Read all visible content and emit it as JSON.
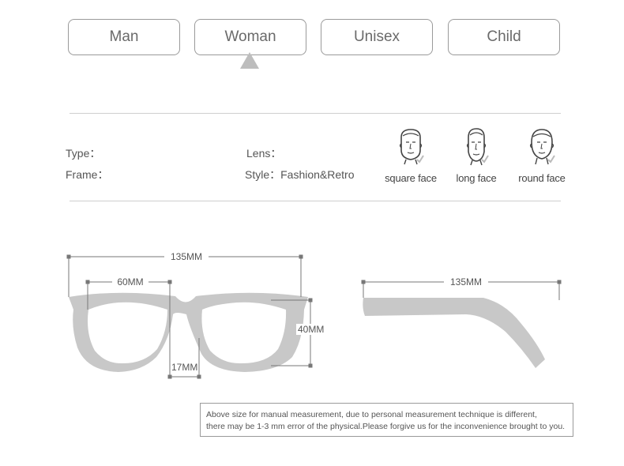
{
  "tabs": [
    {
      "label": "Man"
    },
    {
      "label": "Woman",
      "selected": true
    },
    {
      "label": "Unisex"
    },
    {
      "label": "Child"
    }
  ],
  "specs": {
    "type_label": "Type：",
    "frame_label": "Frame：",
    "lens_label": "Lens：",
    "style_label": "Style：Fashion&Retro"
  },
  "faces": [
    {
      "label": "square face",
      "icon": "square-face-icon",
      "suitable": true
    },
    {
      "label": "long face",
      "icon": "long-face-icon",
      "suitable": true
    },
    {
      "label": "round face",
      "icon": "round-face-icon",
      "suitable": true
    }
  ],
  "dimensions": {
    "frame_width": "135MM",
    "lens_width": "60MM",
    "bridge": "17MM",
    "lens_height": "40MM",
    "temple_length": "135MM"
  },
  "notice": {
    "line1": "Above size for manual measurement, due to personal measurement technique is different,",
    "line2": "there may be 1-3 mm error of the physical.Please forgive us for the inconvenience brought to you."
  },
  "colors": {
    "frame": "#c8c8c8",
    "border": "#9a9a9a",
    "text": "#555555",
    "accent_arrow": "#bdbdbd"
  }
}
